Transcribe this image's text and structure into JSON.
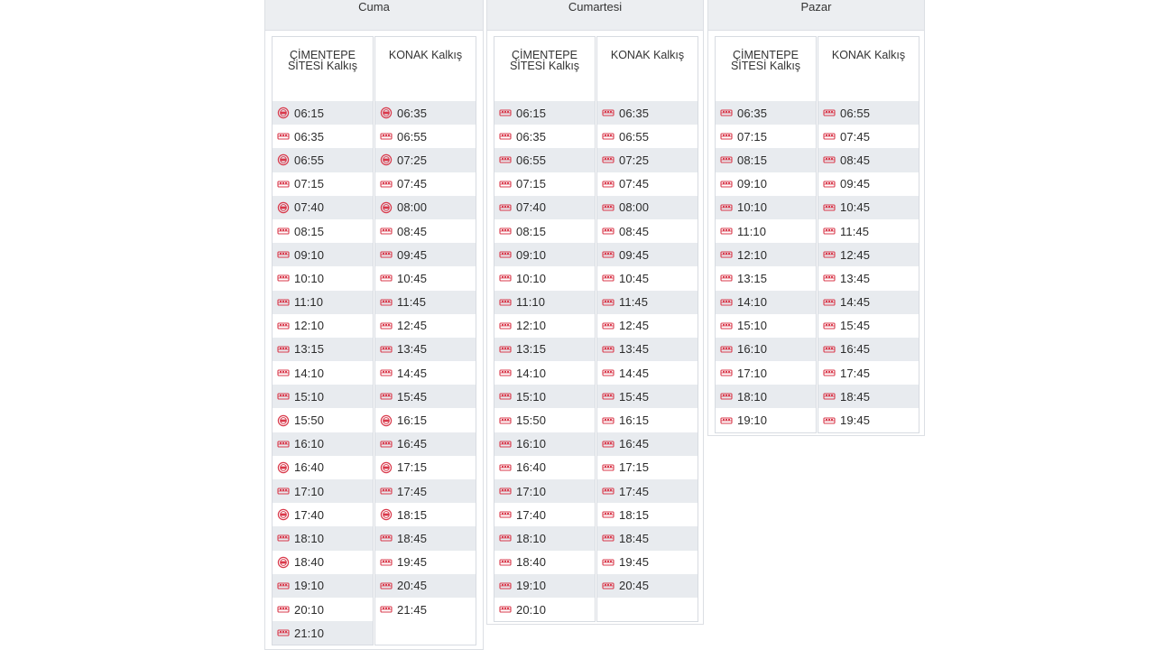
{
  "days": [
    {
      "name": "Cuma",
      "columns": [
        {
          "title_line1": "ÇİMENTEPE",
          "title_line2": "SİTESİ Kalkış",
          "rows": [
            {
              "time": "06:15",
              "icon": "special-bus-icon"
            },
            {
              "time": "06:35",
              "icon": "bus-icon"
            },
            {
              "time": "06:55",
              "icon": "special-bus-icon"
            },
            {
              "time": "07:15",
              "icon": "bus-icon"
            },
            {
              "time": "07:40",
              "icon": "special-bus-icon"
            },
            {
              "time": "08:15",
              "icon": "bus-icon"
            },
            {
              "time": "09:10",
              "icon": "bus-icon"
            },
            {
              "time": "10:10",
              "icon": "bus-icon"
            },
            {
              "time": "11:10",
              "icon": "bus-icon"
            },
            {
              "time": "12:10",
              "icon": "bus-icon"
            },
            {
              "time": "13:15",
              "icon": "bus-icon"
            },
            {
              "time": "14:10",
              "icon": "bus-icon"
            },
            {
              "time": "15:10",
              "icon": "bus-icon"
            },
            {
              "time": "15:50",
              "icon": "special-bus-icon"
            },
            {
              "time": "16:10",
              "icon": "bus-icon"
            },
            {
              "time": "16:40",
              "icon": "special-bus-icon"
            },
            {
              "time": "17:10",
              "icon": "bus-icon"
            },
            {
              "time": "17:40",
              "icon": "special-bus-icon"
            },
            {
              "time": "18:10",
              "icon": "bus-icon"
            },
            {
              "time": "18:40",
              "icon": "special-bus-icon"
            },
            {
              "time": "19:10",
              "icon": "bus-icon"
            },
            {
              "time": "20:10",
              "icon": "bus-icon"
            },
            {
              "time": "21:10",
              "icon": "bus-icon"
            }
          ]
        },
        {
          "title_line1": "KONAK Kalkış",
          "title_line2": "",
          "rows": [
            {
              "time": "06:35",
              "icon": "special-bus-icon"
            },
            {
              "time": "06:55",
              "icon": "bus-icon"
            },
            {
              "time": "07:25",
              "icon": "special-bus-icon"
            },
            {
              "time": "07:45",
              "icon": "bus-icon"
            },
            {
              "time": "08:00",
              "icon": "special-bus-icon"
            },
            {
              "time": "08:45",
              "icon": "bus-icon"
            },
            {
              "time": "09:45",
              "icon": "bus-icon"
            },
            {
              "time": "10:45",
              "icon": "bus-icon"
            },
            {
              "time": "11:45",
              "icon": "bus-icon"
            },
            {
              "time": "12:45",
              "icon": "bus-icon"
            },
            {
              "time": "13:45",
              "icon": "bus-icon"
            },
            {
              "time": "14:45",
              "icon": "bus-icon"
            },
            {
              "time": "15:45",
              "icon": "bus-icon"
            },
            {
              "time": "16:15",
              "icon": "special-bus-icon"
            },
            {
              "time": "16:45",
              "icon": "bus-icon"
            },
            {
              "time": "17:15",
              "icon": "special-bus-icon"
            },
            {
              "time": "17:45",
              "icon": "bus-icon"
            },
            {
              "time": "18:15",
              "icon": "special-bus-icon"
            },
            {
              "time": "18:45",
              "icon": "bus-icon"
            },
            {
              "time": "19:45",
              "icon": "bus-icon"
            },
            {
              "time": "20:45",
              "icon": "bus-icon"
            },
            {
              "time": "21:45",
              "icon": "bus-icon"
            }
          ]
        }
      ]
    },
    {
      "name": "Cumartesi",
      "columns": [
        {
          "title_line1": "ÇİMENTEPE",
          "title_line2": "SİTESİ Kalkış",
          "rows": [
            {
              "time": "06:15",
              "icon": "bus-icon"
            },
            {
              "time": "06:35",
              "icon": "bus-icon"
            },
            {
              "time": "06:55",
              "icon": "bus-icon"
            },
            {
              "time": "07:15",
              "icon": "bus-icon"
            },
            {
              "time": "07:40",
              "icon": "bus-icon"
            },
            {
              "time": "08:15",
              "icon": "bus-icon"
            },
            {
              "time": "09:10",
              "icon": "bus-icon"
            },
            {
              "time": "10:10",
              "icon": "bus-icon"
            },
            {
              "time": "11:10",
              "icon": "bus-icon"
            },
            {
              "time": "12:10",
              "icon": "bus-icon"
            },
            {
              "time": "13:15",
              "icon": "bus-icon"
            },
            {
              "time": "14:10",
              "icon": "bus-icon"
            },
            {
              "time": "15:10",
              "icon": "bus-icon"
            },
            {
              "time": "15:50",
              "icon": "bus-icon"
            },
            {
              "time": "16:10",
              "icon": "bus-icon"
            },
            {
              "time": "16:40",
              "icon": "bus-icon"
            },
            {
              "time": "17:10",
              "icon": "bus-icon"
            },
            {
              "time": "17:40",
              "icon": "bus-icon"
            },
            {
              "time": "18:10",
              "icon": "bus-icon"
            },
            {
              "time": "18:40",
              "icon": "bus-icon"
            },
            {
              "time": "19:10",
              "icon": "bus-icon"
            },
            {
              "time": "20:10",
              "icon": "bus-icon"
            }
          ]
        },
        {
          "title_line1": "KONAK Kalkış",
          "title_line2": "",
          "rows": [
            {
              "time": "06:35",
              "icon": "bus-icon"
            },
            {
              "time": "06:55",
              "icon": "bus-icon"
            },
            {
              "time": "07:25",
              "icon": "bus-icon"
            },
            {
              "time": "07:45",
              "icon": "bus-icon"
            },
            {
              "time": "08:00",
              "icon": "bus-icon"
            },
            {
              "time": "08:45",
              "icon": "bus-icon"
            },
            {
              "time": "09:45",
              "icon": "bus-icon"
            },
            {
              "time": "10:45",
              "icon": "bus-icon"
            },
            {
              "time": "11:45",
              "icon": "bus-icon"
            },
            {
              "time": "12:45",
              "icon": "bus-icon"
            },
            {
              "time": "13:45",
              "icon": "bus-icon"
            },
            {
              "time": "14:45",
              "icon": "bus-icon"
            },
            {
              "time": "15:45",
              "icon": "bus-icon"
            },
            {
              "time": "16:15",
              "icon": "bus-icon"
            },
            {
              "time": "16:45",
              "icon": "bus-icon"
            },
            {
              "time": "17:15",
              "icon": "bus-icon"
            },
            {
              "time": "17:45",
              "icon": "bus-icon"
            },
            {
              "time": "18:15",
              "icon": "bus-icon"
            },
            {
              "time": "18:45",
              "icon": "bus-icon"
            },
            {
              "time": "19:45",
              "icon": "bus-icon"
            },
            {
              "time": "20:45",
              "icon": "bus-icon"
            }
          ]
        }
      ]
    },
    {
      "name": "Pazar",
      "columns": [
        {
          "title_line1": "ÇİMENTEPE",
          "title_line2": "SİTESİ Kalkış",
          "rows": [
            {
              "time": "06:35",
              "icon": "bus-icon"
            },
            {
              "time": "07:15",
              "icon": "bus-icon"
            },
            {
              "time": "08:15",
              "icon": "bus-icon"
            },
            {
              "time": "09:10",
              "icon": "bus-icon"
            },
            {
              "time": "10:10",
              "icon": "bus-icon"
            },
            {
              "time": "11:10",
              "icon": "bus-icon"
            },
            {
              "time": "12:10",
              "icon": "bus-icon"
            },
            {
              "time": "13:15",
              "icon": "bus-icon"
            },
            {
              "time": "14:10",
              "icon": "bus-icon"
            },
            {
              "time": "15:10",
              "icon": "bus-icon"
            },
            {
              "time": "16:10",
              "icon": "bus-icon"
            },
            {
              "time": "17:10",
              "icon": "bus-icon"
            },
            {
              "time": "18:10",
              "icon": "bus-icon"
            },
            {
              "time": "19:10",
              "icon": "bus-icon"
            }
          ]
        },
        {
          "title_line1": "KONAK Kalkış",
          "title_line2": "",
          "rows": [
            {
              "time": "06:55",
              "icon": "bus-icon"
            },
            {
              "time": "07:45",
              "icon": "bus-icon"
            },
            {
              "time": "08:45",
              "icon": "bus-icon"
            },
            {
              "time": "09:45",
              "icon": "bus-icon"
            },
            {
              "time": "10:45",
              "icon": "bus-icon"
            },
            {
              "time": "11:45",
              "icon": "bus-icon"
            },
            {
              "time": "12:45",
              "icon": "bus-icon"
            },
            {
              "time": "13:45",
              "icon": "bus-icon"
            },
            {
              "time": "14:45",
              "icon": "bus-icon"
            },
            {
              "time": "15:45",
              "icon": "bus-icon"
            },
            {
              "time": "16:45",
              "icon": "bus-icon"
            },
            {
              "time": "17:45",
              "icon": "bus-icon"
            },
            {
              "time": "18:45",
              "icon": "bus-icon"
            },
            {
              "time": "19:45",
              "icon": "bus-icon"
            }
          ]
        }
      ]
    }
  ],
  "colors": {
    "icon_red": "#d9394b",
    "stripe": "#e8ebef",
    "header_bg": "#eceef1",
    "border": "#d7dbe1"
  }
}
